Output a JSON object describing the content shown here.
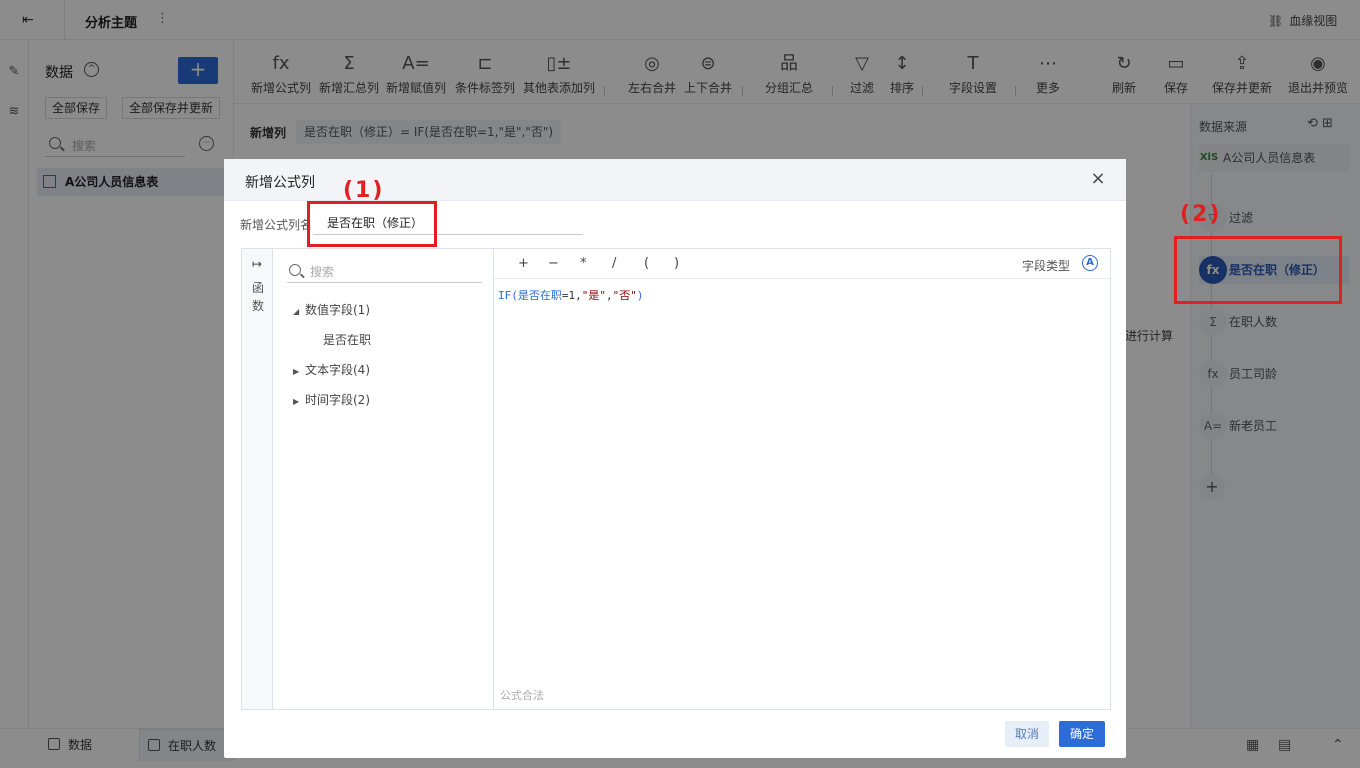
{
  "topbar": {
    "back_icon": "exit-icon",
    "title": "分析主题",
    "menu_dots": "⋮",
    "lineage_label": "血缘视图"
  },
  "data_panel": {
    "title": "数据",
    "add_label": "+",
    "save_all": "全部保存",
    "save_all_update": "全部保存并更新",
    "search_placeholder": "搜索",
    "more_label": "···",
    "table_name": "A公司人员信息表"
  },
  "toolbar": {
    "items": [
      "新增公式列",
      "新增汇总列",
      "新增赋值列",
      "条件标签列",
      "其他表添加列",
      "左右合并",
      "上下合并",
      "分组汇总",
      "过滤",
      "排序",
      "字段设置",
      "更多",
      "刷新",
      "保存",
      "保存并更新",
      "退出并预览"
    ],
    "icons": [
      "fx",
      "Σ",
      "A=",
      "⊏",
      "▯±",
      "◎",
      "⊜",
      "品",
      "▽",
      "↕",
      "T",
      "⋯",
      "↻",
      "▭",
      "⇪",
      "◉"
    ]
  },
  "formula_bar": {
    "label": "新增列",
    "expression": "是否在职（修正）= IF(是否在职=1,\"是\",\"否\")"
  },
  "workarea": {
    "calc_text": "进行计算"
  },
  "right_panel": {
    "title": "数据来源",
    "steps": [
      {
        "icon": "XlS",
        "label": "A公司人员信息表"
      },
      {
        "icon": "▽",
        "label": "过滤"
      },
      {
        "icon": "fx",
        "label": "是否在职（修正）"
      },
      {
        "icon": "Σ",
        "label": "在职人数"
      },
      {
        "icon": "fx",
        "label": "员工司龄"
      },
      {
        "icon": "A=",
        "label": "新老员工"
      }
    ],
    "add": "+"
  },
  "bottom": {
    "tab1": "数据",
    "tab2": "在职人数"
  },
  "dialog": {
    "title": "新增公式列",
    "close": "×",
    "name_label": "新增公式列名",
    "name_value": "是否在职（修正）",
    "fn_arrow": "↦",
    "fn_label": "函数",
    "search_placeholder": "搜索",
    "tree": [
      {
        "label": "数值字段(1)",
        "expanded": true
      },
      {
        "label": "是否在职",
        "child": true
      },
      {
        "label": "文本字段(4)",
        "expanded": false
      },
      {
        "label": "时间字段(2)",
        "expanded": false
      }
    ],
    "ops": [
      "+",
      "−",
      "*",
      "/",
      "(",
      ")"
    ],
    "field_type_label": "字段类型",
    "field_type_icon": "A",
    "code": {
      "fn": "IF(",
      "field": "是否在职",
      "mid": "=1,",
      "s1": "\"是\"",
      "comma": ",",
      "s2": "\"否\"",
      "end": ")"
    },
    "valid_text": "公式合法",
    "cancel": "取消",
    "ok": "确定"
  },
  "annotations": {
    "label1": "(1)",
    "label2": "(2)"
  }
}
